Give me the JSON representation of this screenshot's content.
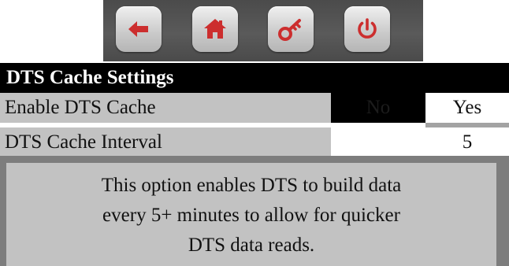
{
  "toolbar": {
    "buttons": [
      {
        "icon": "back-arrow-icon",
        "color": "#cc2e2e"
      },
      {
        "icon": "home-icon",
        "color": "#cc2e2e"
      },
      {
        "icon": "key-icon",
        "color": "#cc2e2e"
      },
      {
        "icon": "power-icon",
        "color": "#cc2e2e"
      }
    ]
  },
  "header": {
    "title": "DTS Cache Settings"
  },
  "settings": {
    "enable_cache": {
      "label": "Enable DTS Cache",
      "option_off": "No",
      "option_on": "Yes",
      "selected": "Yes"
    },
    "interval": {
      "label": "DTS Cache Interval",
      "value": "5"
    }
  },
  "help": {
    "lines": [
      "This option enables DTS to build data",
      "every 5+ minutes to allow for quicker",
      "DTS data reads."
    ]
  },
  "colors": {
    "icon_red": "#cc2e2e",
    "header_bg": "#000000",
    "row_bg": "#c2c2c2",
    "help_border": "#7d7d7d"
  }
}
